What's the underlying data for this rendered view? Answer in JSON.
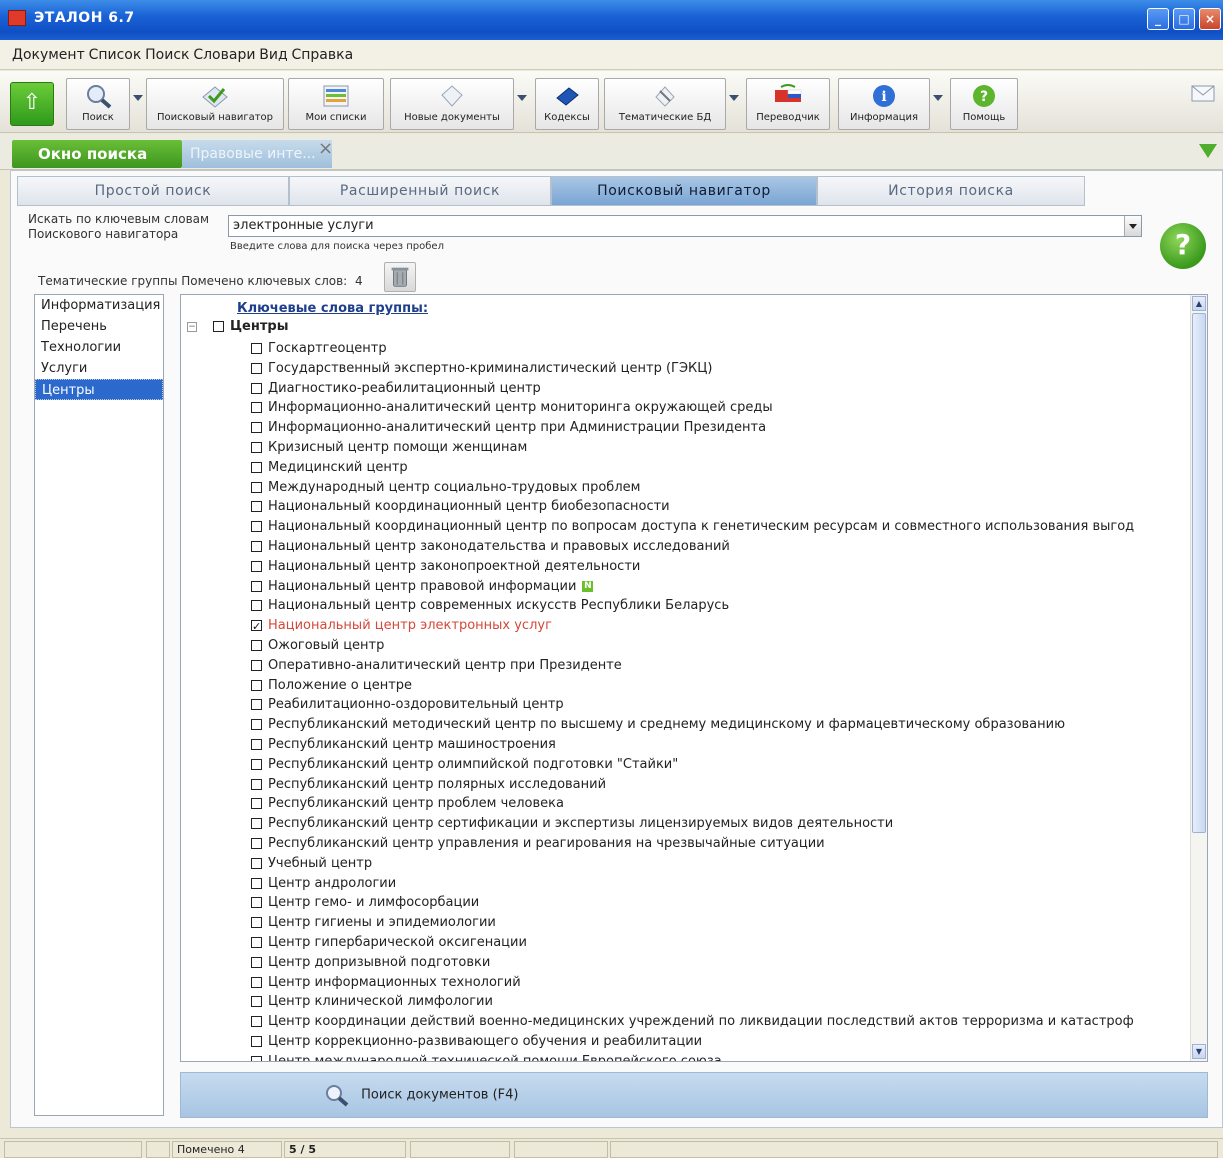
{
  "window": {
    "title": "ЭТАЛОН 6.7"
  },
  "menu": [
    "Документ",
    "Список",
    "Поиск",
    "Словари",
    "Вид",
    "Справка"
  ],
  "toolbar": {
    "buttons": [
      {
        "label": "Поиск",
        "icon": "magnifier-icon"
      },
      {
        "label": "Поисковый навигатор",
        "icon": "navigator-icon"
      },
      {
        "label": "Мои списки",
        "icon": "lists-icon"
      },
      {
        "label": "Новые документы",
        "icon": "new-docs-icon"
      },
      {
        "label": "Кодексы",
        "icon": "codex-icon"
      },
      {
        "label": "Тематические БД",
        "icon": "thematic-db-icon"
      },
      {
        "label": "Переводчик",
        "icon": "translator-icon"
      },
      {
        "label": "Информация",
        "icon": "info-icon"
      },
      {
        "label": "Помощь",
        "icon": "help-icon"
      }
    ]
  },
  "doc_tabs": {
    "active": "Окно поиска",
    "inactive": "Правовые инте..."
  },
  "mode_tabs": [
    "Простой поиск",
    "Расширенный поиск",
    "Поисковый навигатор",
    "История поиска"
  ],
  "search": {
    "label_line1": "Искать по ключевым словам",
    "label_line2": "Поискового навигатора",
    "value": "электронные услуги",
    "hint": "Введите слова для поиска через пробел"
  },
  "groups_line": {
    "label": "Тематические группы",
    "marked_label": "Помечено ключевых слов:",
    "marked_count": "4"
  },
  "groups": [
    "Информатизация",
    "Перечень",
    "Технологии",
    "Услуги",
    "Центры"
  ],
  "selected_group": "Центры",
  "keywords": {
    "header": "Ключевые слова группы:",
    "group": "Центры",
    "items": [
      "Госкартгеоцентр",
      "Государственный экспертно-криминалистический центр (ГЭКЦ)",
      "Диагностико-реабилитационный центр",
      "Информационно-аналитический центр мониторинга окружающей среды",
      "Информационно-аналитический центр при Администрации Президента",
      "Кризисный центр помощи женщинам",
      "Медицинский центр",
      "Международный центр социально-трудовых проблем",
      "Национальный координационный центр биобезопасности",
      "Национальный координационный центр по вопросам доступа к генетическим ресурсам и совместного использования выгод",
      "Национальный центр законодательства и правовых исследований",
      "Национальный центр законопроектной деятельности",
      "Национальный центр правовой информации",
      "Национальный центр современных искусств Республики Беларусь",
      "Национальный центр электронных услуг",
      "Ожоговый центр",
      "Оперативно-аналитический центр при Президенте",
      "Положение о центре",
      "Реабилитационно-оздоровительный центр",
      "Республиканский методический центр по высшему и среднему медицинскому и фармацевтическому образованию",
      "Республиканский центр машиностроения",
      "Республиканский центр олимпийской подготовки \"Стайки\"",
      "Республиканский центр полярных исследований",
      "Республиканский центр проблем человека",
      "Республиканский центр сертификации и экспертизы лицензируемых видов деятельности",
      "Республиканский центр управления и реагирования на чрезвычайные ситуации",
      "Учебный центр",
      "Центр андрологии",
      "Центр гемо- и лимфосорбации",
      "Центр гигиены и эпидемиологии",
      "Центр гипербарической оксигенации",
      "Центр допризывной подготовки",
      "Центр информационных технологий",
      "Центр клинической лимфологии",
      "Центр координации действий военно-медицинских учреждений по ликвидации последствий актов терроризма и катастроф",
      "Центр коррекционно-развивающего обучения и реабилитации",
      "Центр международной технической помощи Европейского союза"
    ],
    "checked_index": 14,
    "new_flag_index": 12,
    "new_flag_text": "N",
    "highlight_color": "#d4483a"
  },
  "search_button": {
    "label": "Поиск документов (F4)"
  },
  "status": {
    "marked": "Помечено 4",
    "position": "5 / 5"
  },
  "colors": {
    "accent_green": "#4fae2d",
    "selection_blue": "#2b6acc",
    "title_blue": "#1a62d6"
  }
}
